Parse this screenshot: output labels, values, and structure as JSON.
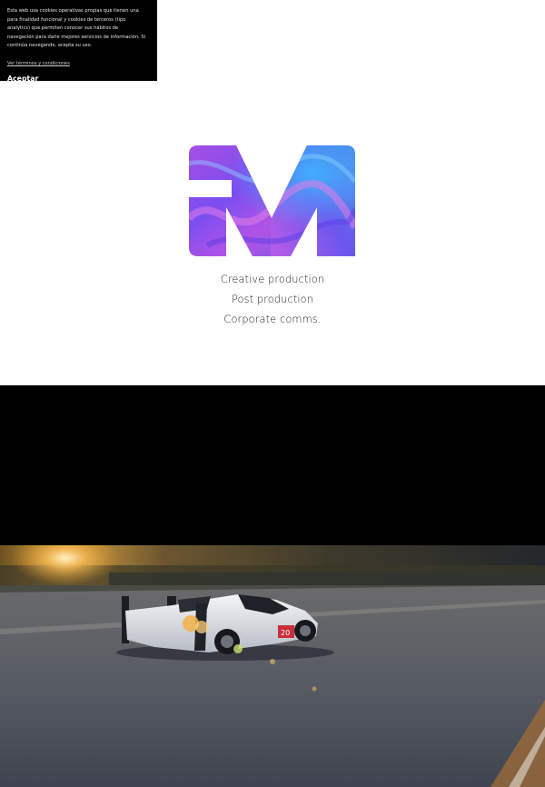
{
  "cookie_banner": {
    "text": "Esta web usa cookies operativas propias que tienen una para finalidad funcional y cookies de terceros (tipo analytics) que permiten conocer sus hábitos de navegación para darle mejores servicios de información. Si continúa navegando, acepta su uso.",
    "link_label": "Ver términos y condiciones",
    "accept_label": "Aceptar"
  },
  "logo": {
    "icon": "brand-m-logo",
    "colors": [
      "#b04be0",
      "#6f52f0",
      "#3e6ee8",
      "#c160e8"
    ]
  },
  "taglines": [
    "Creative production",
    "Post production",
    "Corporate comms."
  ],
  "video": {
    "scene": "race-car-sunset",
    "colors": {
      "sky": "#c8912e",
      "road": "#5b5e67",
      "car_body": "#e6e8ec"
    }
  }
}
